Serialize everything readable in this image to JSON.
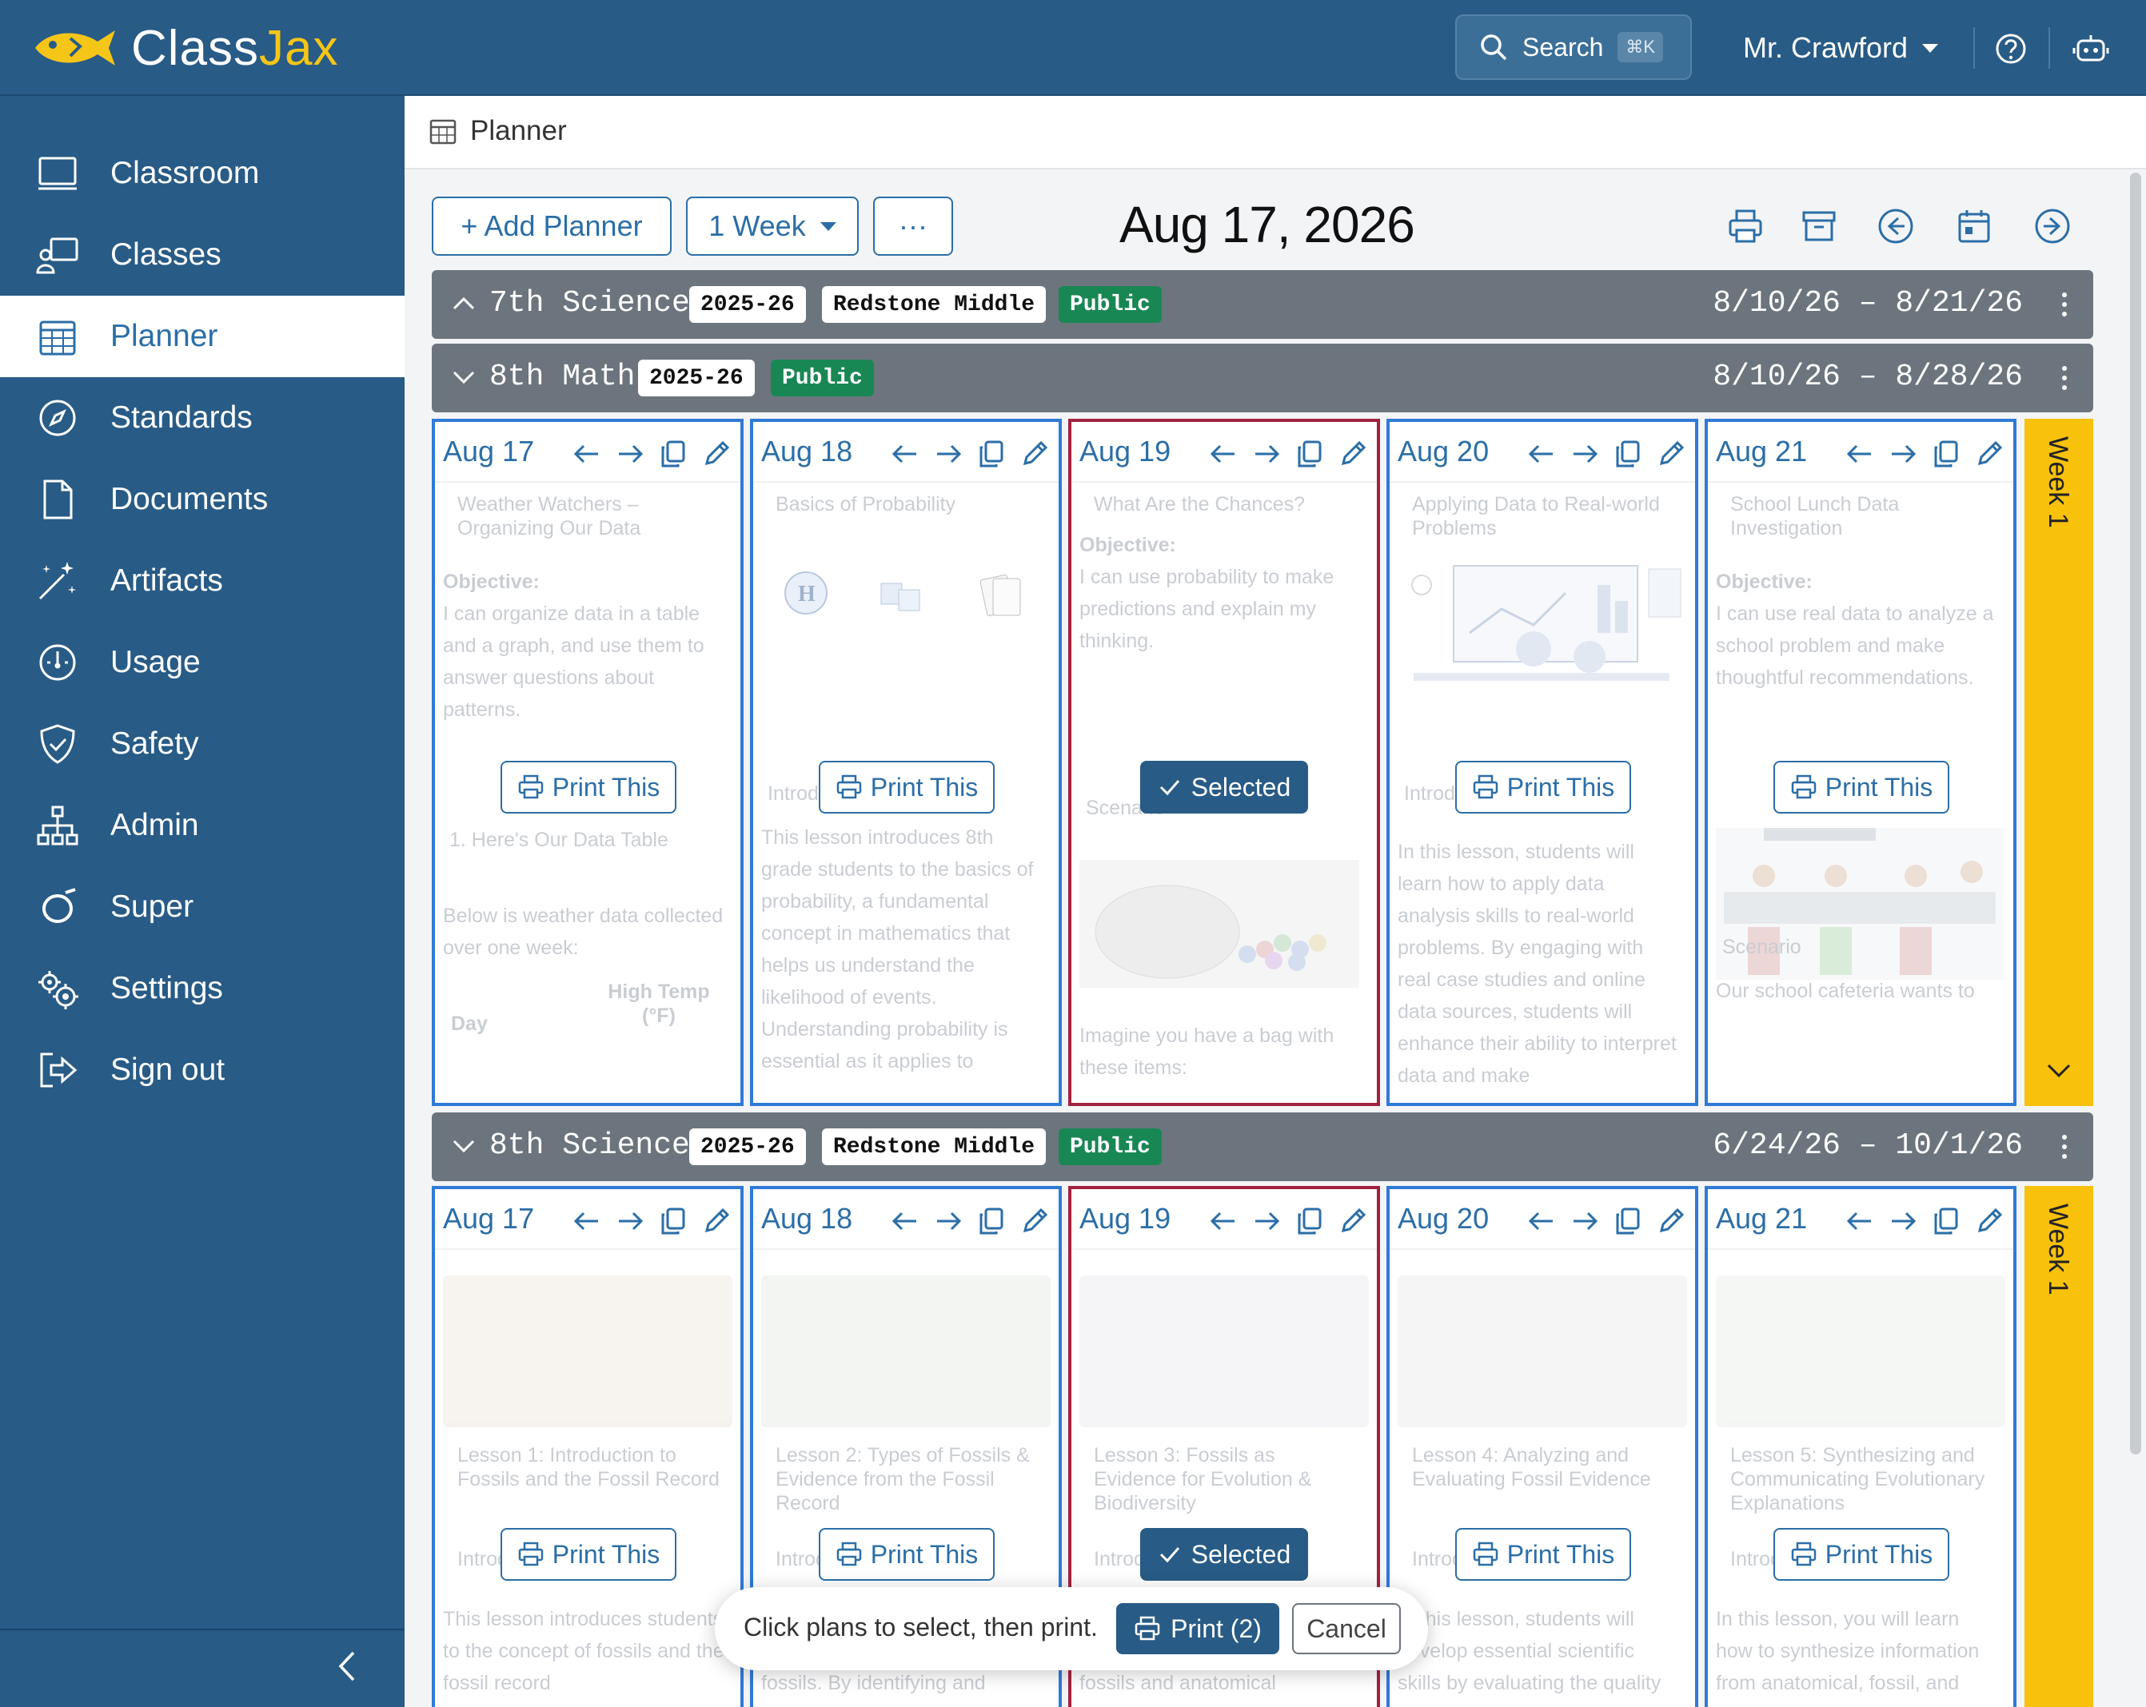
{
  "app": {
    "logo_class": "Class",
    "logo_jax": "Jax",
    "search_label": "Search",
    "search_shortcut": "⌘K",
    "user_name": "Mr. Crawford"
  },
  "sidebar": {
    "items": [
      {
        "label": "Classroom",
        "icon": "monitor-icon"
      },
      {
        "label": "Classes",
        "icon": "presenter-icon"
      },
      {
        "label": "Planner",
        "icon": "calendar-icon",
        "active": true
      },
      {
        "label": "Standards",
        "icon": "compass-icon"
      },
      {
        "label": "Documents",
        "icon": "file-icon"
      },
      {
        "label": "Artifacts",
        "icon": "magic-wand-icon"
      },
      {
        "label": "Usage",
        "icon": "gauge-icon"
      },
      {
        "label": "Safety",
        "icon": "shield-check-icon"
      },
      {
        "label": "Admin",
        "icon": "org-chart-icon"
      },
      {
        "label": "Super",
        "icon": "ring-icon"
      },
      {
        "label": "Settings",
        "icon": "gears-icon"
      },
      {
        "label": "Sign out",
        "icon": "sign-out-icon"
      }
    ]
  },
  "breadcrumb": {
    "label": "Planner"
  },
  "toolbar": {
    "add_planner": "+ Add Planner",
    "range_select": "1 Week",
    "more": "···",
    "date_title": "Aug 17, 2026"
  },
  "planners": [
    {
      "name": "7th Science",
      "year": "2025-26",
      "school": "Redstone Middle",
      "visibility": "Public",
      "range": "8/10/26 – 8/21/26",
      "expanded": false
    },
    {
      "name": "8th Math",
      "year": "2025-26",
      "visibility": "Public",
      "range": "8/10/26 – 8/28/26",
      "expanded": true,
      "week_label": "Week 1",
      "days": [
        {
          "date": "Aug 17",
          "title": "Weather Watchers – Organizing Our Data",
          "objective_label": "Objective:",
          "objective": "I can organize data in a table and a graph, and use them to answer questions about patterns.",
          "extra1": "1. Here's Our Data Table",
          "extra2": "Below is weather data collected over one week:",
          "table_col1": "Day",
          "table_col2": "High Temp (°F)",
          "button": "Print This"
        },
        {
          "date": "Aug 18",
          "title": "Basics of Probability",
          "section": "Introduction",
          "body": "This lesson introduces 8th grade students to the basics of probability, a fundamental concept in mathematics that helps us understand the likelihood of events. Understanding probability is essential as it applies to",
          "button": "Print This"
        },
        {
          "date": "Aug 19",
          "title": "What Are the Chances?",
          "objective_label": "Objective:",
          "objective": "I can use probability to make predictions and explain my thinking.",
          "section": "Scenario",
          "body": "Imagine you have a bag with these items:",
          "button": "Selected",
          "selected": true
        },
        {
          "date": "Aug 20",
          "title": "Applying Data to Real-world Problems",
          "section": "Introduction",
          "body": "In this lesson, students will learn how to apply data analysis skills to real-world problems. By engaging with real case studies and online data sources, students will enhance their ability to interpret data and make",
          "button": "Print This"
        },
        {
          "date": "Aug 21",
          "title": "School Lunch Data Investigation",
          "objective_label": "Objective:",
          "objective": "I can use real data to analyze a school problem and make thoughtful recommendations.",
          "section": "Scenario",
          "body": "Our school cafeteria wants to",
          "button": "Print This"
        }
      ]
    },
    {
      "name": "8th Science",
      "year": "2025-26",
      "school": "Redstone Middle",
      "visibility": "Public",
      "range": "6/24/26 – 10/1/26",
      "expanded": true,
      "week_label": "Week 1",
      "days": [
        {
          "date": "Aug 17",
          "title": "Lesson 1: Introduction to Fossils and the Fossil Record",
          "section": "Introduction",
          "body": "This lesson introduces students to the concept of fossils and the fossil record",
          "button": "Print This"
        },
        {
          "date": "Aug 18",
          "title": "Lesson 2: Types of Fossils & Evidence from the Fossil Record",
          "section": "Introduction",
          "body": "explore the fascinating world of fossils. By identifying and",
          "button": "Print This"
        },
        {
          "date": "Aug 19",
          "title": "Lesson 3: Fossils as Evidence for Evolution & Biodiversity",
          "section": "Introduction",
          "body": "explore how scientists use fossils and anatomical",
          "button": "Selected",
          "selected": true
        },
        {
          "date": "Aug 20",
          "title": "Lesson 4: Analyzing and Evaluating Fossil Evidence",
          "section": "Introduction",
          "body": "In this lesson, students will develop essential scientific skills by evaluating the quality",
          "button": "Print This"
        },
        {
          "date": "Aug 21",
          "title": "Lesson 5: Synthesizing and Communicating Evolutionary Explanations",
          "section": "Introduction",
          "body": "In this lesson, you will learn how to synthesize information from anatomical, fossil, and",
          "button": "Print This"
        }
      ]
    }
  ],
  "print_toast": {
    "message": "Click plans to select, then print.",
    "print_label": "Print (2)",
    "cancel_label": "Cancel"
  },
  "colors": {
    "brand": "#285b86",
    "accent": "#2b6ea7",
    "selected_border": "#a1223f",
    "week_tab": "#f8c10b",
    "public_badge": "#198754"
  }
}
